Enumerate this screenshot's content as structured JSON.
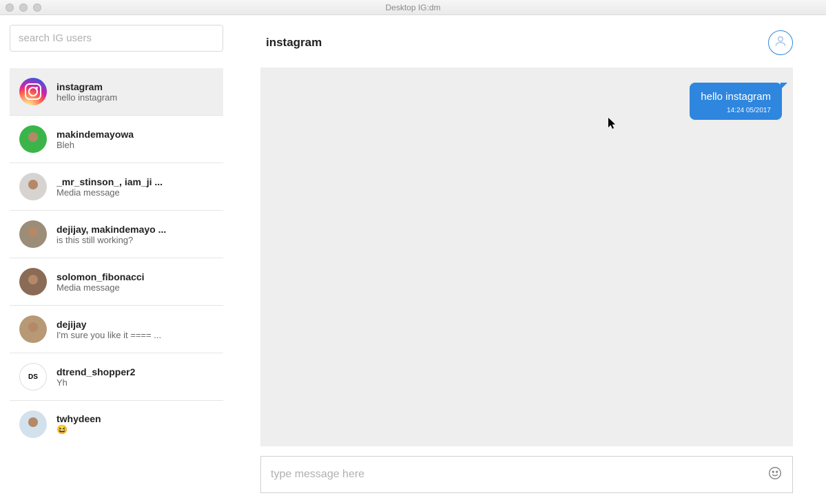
{
  "window": {
    "title": "Desktop IG:dm"
  },
  "sidebar": {
    "search_placeholder": "search IG users",
    "conversations": [
      {
        "name": "instagram",
        "preview": "hello instagram",
        "avatar_class": "av-insta",
        "active": true
      },
      {
        "name": "makindemayowa",
        "preview": "Bleh",
        "avatar_class": "av-green"
      },
      {
        "name": "_mr_stinson_, iam_ji ...",
        "preview": "Media message",
        "avatar_class": "av-gray"
      },
      {
        "name": "dejijay, makindemayo ...",
        "preview": "is this still working?",
        "avatar_class": "av-tan"
      },
      {
        "name": "solomon_fibonacci",
        "preview": "Media message",
        "avatar_class": "av-brown"
      },
      {
        "name": "dejijay",
        "preview": "I'm sure you like it ==== ...",
        "avatar_class": "av-sepia"
      },
      {
        "name": "dtrend_shopper2",
        "preview": "Yh",
        "avatar_class": "av-white",
        "avatar_text": "DS"
      },
      {
        "name": "twhydeen",
        "preview": "😆",
        "avatar_class": "av-lblue"
      }
    ]
  },
  "chat": {
    "title": "instagram",
    "messages": [
      {
        "text": "hello instagram",
        "time": "14:24 05/2017",
        "outgoing": true
      }
    ],
    "compose_placeholder": "type message here"
  }
}
